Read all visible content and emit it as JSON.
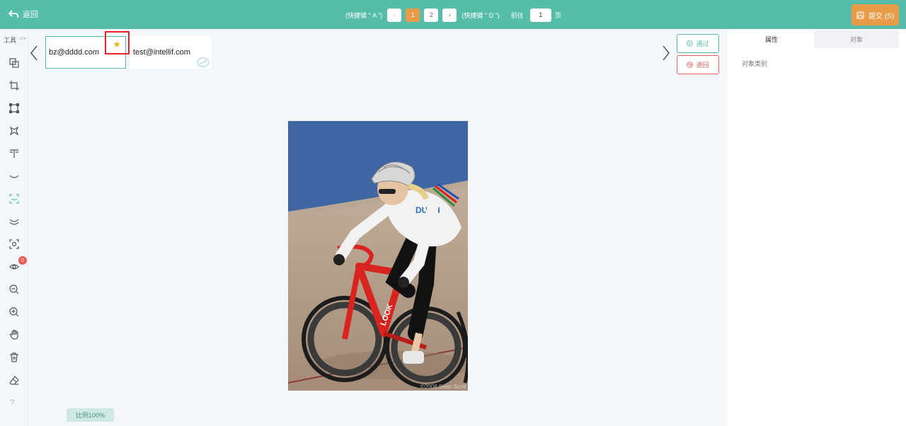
{
  "header": {
    "back_label": "返回",
    "hint_prev": "(快捷键 \" A \")",
    "prev_symbol": "‹",
    "pages": [
      "1",
      "2"
    ],
    "active_page": "1",
    "next_symbol": "›",
    "hint_next": "(快捷键 \" D \")",
    "goto_label": "前往",
    "goto_value": "1",
    "page_suffix": "页",
    "submit_label": "提交 (S)"
  },
  "toolbar": {
    "title": "工具",
    "expand": ">>",
    "tools": [
      "crop-copy-icon",
      "crop-icon",
      "rectangle-icon",
      "polygon-icon",
      "text-tool-icon",
      "curve-icon",
      "keypoint-box-icon",
      "double-curve-icon",
      "focus-icon",
      "eye-icon",
      "zoom-out-icon",
      "zoom-in-icon",
      "hand-icon",
      "trash-icon",
      "eraser-icon",
      "help-icon"
    ],
    "badge_count": "0",
    "help_symbol": "?"
  },
  "annotators": [
    {
      "email": "bz@dddd.com",
      "starred": true,
      "selected": true
    },
    {
      "email": "test@intellif.com",
      "starred": false,
      "selected": false
    }
  ],
  "actions": {
    "pass_label": "通过",
    "reject_label": "退回"
  },
  "image": {
    "watermark": "©2008 Sean Scott",
    "jersey_text": "DUCH",
    "bike_brand": "LOOK"
  },
  "zoom_label": "比例100%",
  "panel": {
    "tabs": [
      "属性",
      "对象"
    ],
    "active_tab": "属性",
    "object_class_label": "对象类别"
  },
  "colors": {
    "accent": "#55bda9",
    "submit": "#e99b48",
    "danger": "#e85c5c",
    "star": "#e6b825",
    "highlight": "#e0242a"
  }
}
